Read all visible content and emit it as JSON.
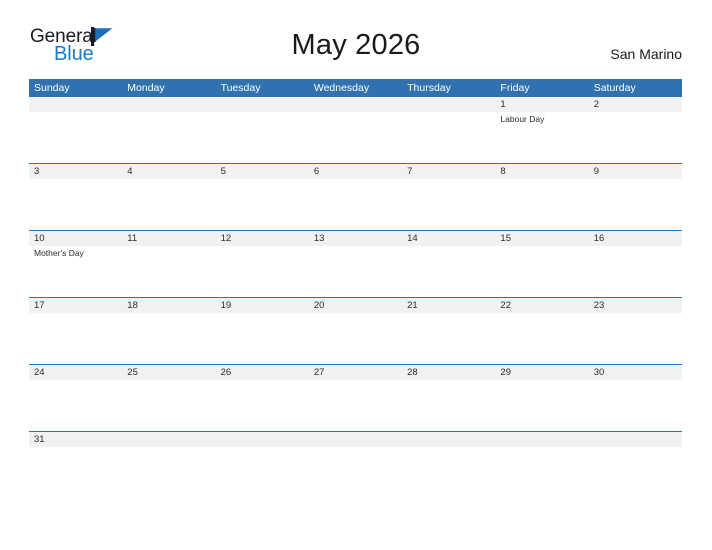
{
  "brand": {
    "line1": "General",
    "line2": "Blue",
    "flag_icon": "triangle-flag-icon",
    "line1_color": "#1b1b26",
    "line2_color": "#1c7ac0",
    "flag_color": "#1c6fb5"
  },
  "header": {
    "title": "May 2026",
    "locale": "San Marino"
  },
  "theme": {
    "header_blue": "#3071b0",
    "separator_blue": "#2e74b5",
    "date_band_gray": "#f1f1f1",
    "text_dark": "#2b2b2b",
    "page_background": "#ffffff"
  },
  "calendar": {
    "month": "May",
    "year": "2026",
    "weekdays": [
      "Sunday",
      "Monday",
      "Tuesday",
      "Wednesday",
      "Thursday",
      "Friday",
      "Saturday"
    ],
    "weeks": [
      {
        "dates": [
          "",
          "",
          "",
          "",
          "",
          "1",
          "2"
        ],
        "events": [
          "",
          "",
          "",
          "",
          "",
          "Labour Day",
          ""
        ]
      },
      {
        "dates": [
          "3",
          "4",
          "5",
          "6",
          "7",
          "8",
          "9"
        ],
        "events": [
          "",
          "",
          "",
          "",
          "",
          "",
          ""
        ]
      },
      {
        "dates": [
          "10",
          "11",
          "12",
          "13",
          "14",
          "15",
          "16"
        ],
        "events": [
          "Mother's Day",
          "",
          "",
          "",
          "",
          "",
          ""
        ]
      },
      {
        "dates": [
          "17",
          "18",
          "19",
          "20",
          "21",
          "22",
          "23"
        ],
        "events": [
          "",
          "",
          "",
          "",
          "",
          "",
          ""
        ]
      },
      {
        "dates": [
          "24",
          "25",
          "26",
          "27",
          "28",
          "29",
          "30"
        ],
        "events": [
          "",
          "",
          "",
          "",
          "",
          "",
          ""
        ]
      },
      {
        "dates": [
          "31",
          "",
          "",
          "",
          "",
          "",
          ""
        ],
        "events": [
          "",
          "",
          "",
          "",
          "",
          "",
          ""
        ]
      }
    ]
  }
}
